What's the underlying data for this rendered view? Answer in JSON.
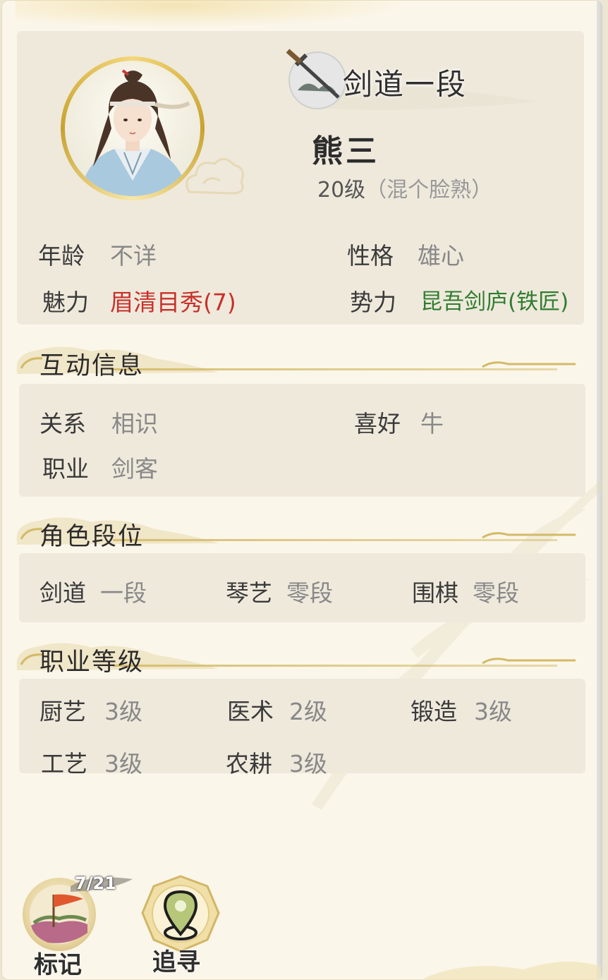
{
  "header": {
    "rank_title": "剑道一段",
    "name": "熊三",
    "level": "20级",
    "level_note": "（混个脸熟）"
  },
  "attributes": {
    "age_label": "年龄",
    "age_value": "不详",
    "personality_label": "性格",
    "personality_value": "雄心",
    "charm_label": "魅力",
    "charm_value": "眉清目秀(7)",
    "faction_label": "势力",
    "faction_value": "昆吾剑庐(铁匠)"
  },
  "colors": {
    "charm": "#c8302a",
    "faction": "#2f7d2f",
    "accent_gold": "#d3ba66"
  },
  "interaction": {
    "title": "互动信息",
    "relation_label": "关系",
    "relation_value": "相识",
    "hobby_label": "喜好",
    "hobby_value": "牛",
    "job_label": "职业",
    "job_value": "剑客"
  },
  "ranks": {
    "title": "角色段位",
    "items": [
      {
        "label": "剑道",
        "value": "一段"
      },
      {
        "label": "琴艺",
        "value": "零段"
      },
      {
        "label": "围棋",
        "value": "零段"
      }
    ]
  },
  "profession_levels": {
    "title": "职业等级",
    "items": [
      {
        "label": "厨艺",
        "value": "3级"
      },
      {
        "label": "医术",
        "value": "2级"
      },
      {
        "label": "锻造",
        "value": "3级"
      },
      {
        "label": "工艺",
        "value": "3级"
      },
      {
        "label": "农耕",
        "value": "3级"
      }
    ]
  },
  "actions": {
    "mark_label": "标记",
    "mark_counter": "7/21",
    "track_label": "追寻"
  },
  "icons": [
    "sword-icon",
    "avatar",
    "flag-icon",
    "location-pin-icon"
  ]
}
